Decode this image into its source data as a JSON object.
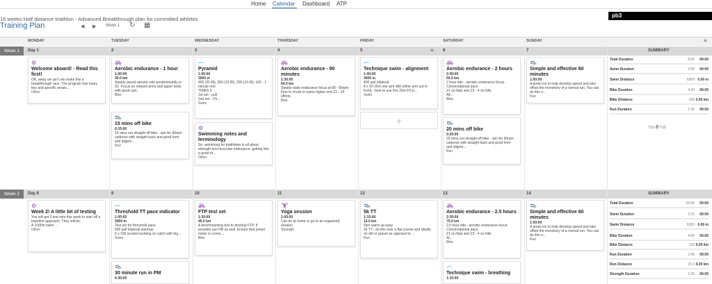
{
  "nav": {
    "home": "Home",
    "calendar": "Calendar",
    "dashboard": "Dashboard",
    "atp": "ATP"
  },
  "plan": {
    "subtitle": "16 weeks Half distance triathlon - Advanced Breakthrough plan for committed athletes",
    "title": "Training Plan",
    "week_label": "Week 1"
  },
  "brand": "pb3",
  "days": [
    "MONDAY",
    "TUESDAY",
    "WEDNESDAY",
    "THURSDAY",
    "FRIDAY",
    "SATURDAY",
    "SUNDAY"
  ],
  "summary_label": "SUMMARY",
  "weeks": [
    {
      "label": "Week 1",
      "daynums": [
        "Day 1",
        "2",
        "3",
        "4",
        "5",
        "6",
        "7"
      ]
    },
    {
      "label": "Week 2",
      "daynums": [
        "Day 8",
        "9",
        "10",
        "11",
        "12",
        "13",
        "14"
      ]
    }
  ],
  "cards": [
    {
      "icon": "other",
      "title": "Welcome aboard! - Read this first!",
      "meta": [],
      "desc": "OK, away we go! Lets make this a breakthrough race. The program has many key and specific sessio...",
      "sport": "Other"
    },
    {
      "icon": "bike",
      "title": "Aerobic endurance - 1 hour",
      "meta": [
        "1:00:00",
        "30.0 km"
      ],
      "desc": "Steady paced aerobic ride predominantly in Z2. Focus on relaxed arms and upper body with good cad...",
      "sport": "Bike"
    },
    {
      "icon": "run",
      "title": "15 mins off bike",
      "meta": [
        "0:15:00"
      ],
      "desc": "15 mins run straight off bike - aim for 90rpm cadence with straight back and good form and alignm...",
      "sport": "Run"
    },
    {
      "icon": "swim",
      "title": "Pyramid",
      "meta": [
        "1:00:00",
        "3000 m"
      ],
      "desc": "400 (20 Rl), 300 (15 Rl), 200 (10 Rl), 100 - 1 minute rest\nTIMES 3\n1st set - pull\n2nd set - FS...",
      "sport": "Swim"
    },
    {
      "icon": "other",
      "title": "Swimming notes and terminology",
      "meta": [],
      "desc": "So, swimming for triathletes is all about strength and muscular endurance, getting into a good rh...",
      "sport": "Other"
    },
    {
      "icon": "bike",
      "title": "Aerobic endurance - 90 minutes",
      "meta": [
        "1:30:00",
        "60.0 km"
      ],
      "desc": "Steady state endurance focus at 80 - 90rpm\nFine to chuck in some higher end Z3 - Z4 efforts",
      "sport": "Bike"
    },
    {
      "icon": "swim",
      "title": "Technique swim - alignment",
      "meta": [
        "1:00:00",
        "3000 m"
      ],
      "desc": "400 pull bilateral\n8 x 50 25m one arm drill (other arm out in front) - best to use fins 25m FS b...",
      "sport": "Swim"
    },
    {
      "icon": "bike",
      "title": "Aerobic endurance - 2 hours",
      "meta": [
        "2:00:00",
        "60.0 km"
      ],
      "desc": "2 hour ride - aerobic endurance focus. Conversational pace\nZ1 on flats and Z3 - 4 on hills\nAll...",
      "sport": "Bike"
    },
    {
      "icon": "run",
      "title": "20 mins off bike",
      "meta": [
        "0:20:00"
      ],
      "desc": "20 mins run straight off bike - aim for 90rpm cadence with straight back and good form and alignm...",
      "sport": "Run"
    },
    {
      "icon": "run",
      "title": "Simple and effective 60 minutes",
      "meta": [
        "1:00:00"
      ],
      "desc": "A great run to help develop speed and also offset the monotony of a normal run. You can do this o...",
      "sport": "Run"
    },
    {
      "icon": "other",
      "title": "Week 2! A little bit of testing",
      "meta": [],
      "desc": "You will get 3 test sets this week to start off a baseline approach. They will be:\nA 1000m swim ...",
      "sport": "Other"
    },
    {
      "icon": "swim",
      "title": "Threshold TT pace indicator",
      "meta": [
        "1:00:00",
        "3000 m"
      ],
      "desc": "Test set for threshold pace\n500 pull bilateral warmup\n5 x 100 snorkel working on catch with hig...",
      "sport": "Swim"
    },
    {
      "icon": "run",
      "title": "30 minute run in PM",
      "meta": [
        "0:30:00"
      ],
      "desc": "",
      "sport": ""
    },
    {
      "icon": "bike",
      "title": "FTP test set",
      "meta": [
        "1:30:00",
        "45.0 km"
      ],
      "desc": "A benchmarking test to develop FTP. If possible use HR as well. Ensure that power meter is correc...",
      "sport": "Bike"
    },
    {
      "icon": "strength",
      "title": "Yoga session",
      "meta": [
        "1:00:00"
      ],
      "desc": "Can do at home or go to an organized session",
      "sport": "Strength"
    },
    {
      "icon": "run",
      "title": "5k TT",
      "meta": [
        "1:15:00",
        "15.0 km"
      ],
      "desc": "5km warm up easy\n5k TT - do this over a flat course and ideally on dirt or gravel as opposed to ...",
      "sport": "Run"
    },
    {
      "icon": "bike",
      "title": "Aerobic endurance - 2.5 hours",
      "meta": [
        "2:30:00",
        "75.0 km"
      ],
      "desc": "2.5 hour ride - aerobic endurance focus. Conversational pace\nZ1 on flats and Z3 - 4 on hills\nAl...",
      "sport": "Bike"
    },
    {
      "icon": "swim",
      "title": "Technique swim - breathing",
      "meta": [
        "1:15:00"
      ],
      "desc": "",
      "sport": ""
    },
    {
      "icon": "run",
      "title": "Simple and effective 60 minutes",
      "meta": [
        "1:00:00"
      ],
      "desc": "A great run to help develop speed and also offset the monotony of a normal run. You can do this o...",
      "sport": "Run"
    }
  ],
  "summary": [
    {
      "rows": [
        {
          "label": "Total Duration",
          "planned": "8:00",
          "actual": "00:00"
        },
        {
          "label": "Swim Duration",
          "planned": "2:00",
          "actual": "00:00"
        },
        {
          "label": "Swim Distance",
          "planned": "6000",
          "actual": "0.00 m"
        },
        {
          "label": "Bike Duration",
          "planned": "4:30",
          "actual": "00:00"
        },
        {
          "label": "Bike Distance",
          "planned": "140",
          "actual": "0.00 km"
        },
        {
          "label": "Run Duration",
          "planned": "1:35",
          "actual": "00:00"
        }
      ],
      "tss_label": "TSS",
      "tss_value": "0",
      "tss_unit": "TSS"
    },
    {
      "rows": [
        {
          "label": "Total Duration",
          "planned": "10:00",
          "actual": "00:00"
        },
        {
          "label": "Swim Duration",
          "planned": "2:15",
          "actual": "00:00"
        },
        {
          "label": "Swim Distance",
          "planned": "6200",
          "actual": "0.00 m"
        },
        {
          "label": "Bike Duration",
          "planned": "4:00",
          "actual": "00:00"
        },
        {
          "label": "Bike Distance",
          "planned": "120",
          "actual": "0.00 km"
        },
        {
          "label": "Run Duration",
          "planned": "2:45",
          "actual": "00:00"
        },
        {
          "label": "Run Distance",
          "planned": "15.0",
          "actual": "0.00 km"
        },
        {
          "label": "Strength Duration",
          "planned": "1:00",
          "actual": "00:00"
        }
      ]
    }
  ],
  "colors": {
    "accent": "#2b6aa8",
    "swim": "#29a3d8",
    "bike": "#8e44ad",
    "run": "#1f4e66",
    "other": "#8e44ad",
    "strength": "#8e44ad"
  }
}
